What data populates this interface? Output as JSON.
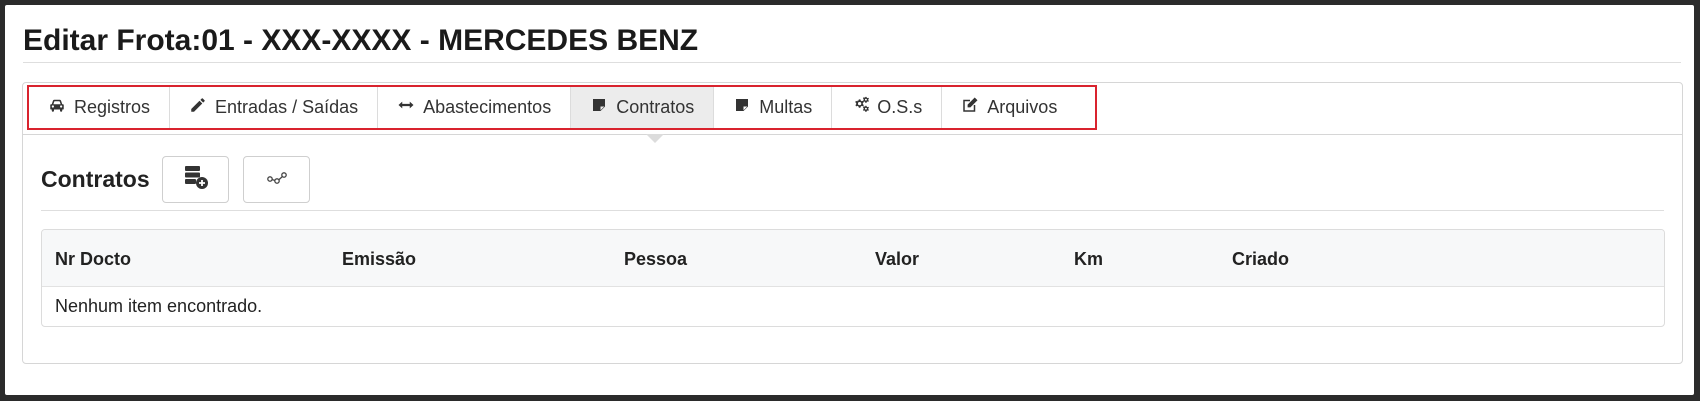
{
  "page": {
    "title": "Editar Frota:01 - XXX-XXXX - MERCEDES BENZ"
  },
  "tabs": [
    {
      "label": "Registros",
      "icon": "car-icon"
    },
    {
      "label": "Entradas / Saídas",
      "icon": "pencil-icon"
    },
    {
      "label": "Abastecimentos",
      "icon": "arrows-horizontal-icon"
    },
    {
      "label": "Contratos",
      "icon": "sticky-note-icon",
      "active": true
    },
    {
      "label": "Multas",
      "icon": "sticky-note-icon"
    },
    {
      "label": "O.S.s",
      "icon": "gears-icon"
    },
    {
      "label": "Arquivos",
      "icon": "edit-icon"
    }
  ],
  "section": {
    "title": "Contratos"
  },
  "toolbar": {
    "add_icon": "database-add-icon",
    "link_icon": "route-icon"
  },
  "table": {
    "columns": [
      "Nr Docto",
      "Emissão",
      "Pessoa",
      "Valor",
      "Km",
      "Criado"
    ],
    "empty_message": "Nenhum item encontrado."
  },
  "colors": {
    "highlight_border": "#d9232e",
    "active_tab_bg": "#ececec"
  }
}
